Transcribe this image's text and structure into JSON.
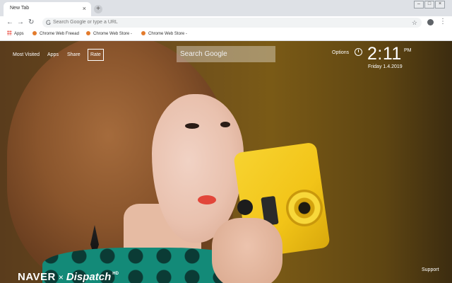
{
  "browser": {
    "tab_title": "New Tab",
    "tab_close": "×",
    "new_tab": "+",
    "omnibox_placeholder": "Search Google or type a URL",
    "bookmarks": [
      {
        "label": "Apps"
      },
      {
        "label": "Chrome Web Freead"
      },
      {
        "label": "Chrome Web Store -"
      },
      {
        "label": "Chrome Web Store -"
      }
    ]
  },
  "newtab": {
    "nav": [
      "Most Visited",
      "Apps",
      "Share",
      "Rate"
    ],
    "search_placeholder": "Search Google",
    "options_label": "Options",
    "time": "2:11",
    "ampm": "PM",
    "date": "Friday  1.4.2019",
    "brand_naver": "NAVER",
    "brand_x": "×",
    "brand_dispatch": "Dispatch",
    "brand_hd": "HD",
    "support_label": "Support"
  },
  "colors": {
    "chrome_frame": "#dee1e6",
    "omnibox_bg": "#f1f3f4",
    "overlay_text": "#ffffff"
  }
}
